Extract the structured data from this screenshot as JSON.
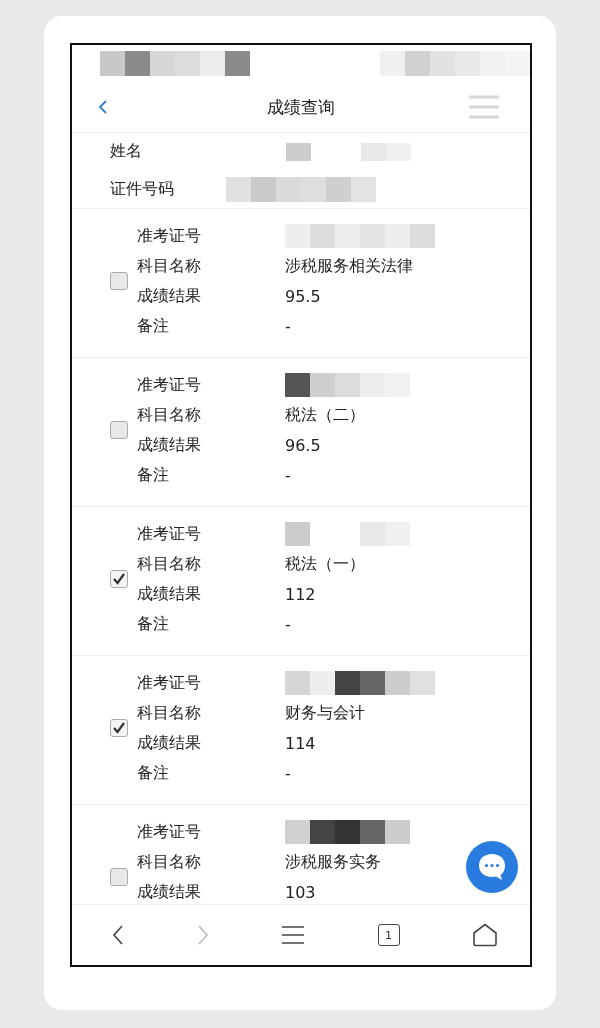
{
  "header": {
    "title": "成绩查询"
  },
  "profile": [
    {
      "label": "姓名",
      "kind": "redacted"
    },
    {
      "label": "证件号码",
      "kind": "redacted"
    }
  ],
  "records": [
    {
      "checked": false,
      "fields": [
        {
          "label": "准考证号",
          "kind": "redacted"
        },
        {
          "label": "科目名称",
          "kind": "text",
          "value": "涉税服务相关法律"
        },
        {
          "label": "成绩结果",
          "kind": "text",
          "value": "95.5"
        },
        {
          "label": "备注",
          "kind": "text",
          "value": "-"
        }
      ]
    },
    {
      "checked": false,
      "fields": [
        {
          "label": "准考证号",
          "kind": "redacted"
        },
        {
          "label": "科目名称",
          "kind": "text",
          "value": "税法（二）"
        },
        {
          "label": "成绩结果",
          "kind": "text",
          "value": "96.5"
        },
        {
          "label": "备注",
          "kind": "text",
          "value": "-"
        }
      ]
    },
    {
      "checked": true,
      "fields": [
        {
          "label": "准考证号",
          "kind": "redacted"
        },
        {
          "label": "科目名称",
          "kind": "text",
          "value": "税法（一）"
        },
        {
          "label": "成绩结果",
          "kind": "text",
          "value": "112"
        },
        {
          "label": "备注",
          "kind": "text",
          "value": "-"
        }
      ]
    },
    {
      "checked": true,
      "fields": [
        {
          "label": "准考证号",
          "kind": "redacted"
        },
        {
          "label": "科目名称",
          "kind": "text",
          "value": "财务与会计"
        },
        {
          "label": "成绩结果",
          "kind": "text",
          "value": "114"
        },
        {
          "label": "备注",
          "kind": "text",
          "value": "-"
        }
      ]
    },
    {
      "checked": false,
      "fields": [
        {
          "label": "准考证号",
          "kind": "redacted"
        },
        {
          "label": "科目名称",
          "kind": "text",
          "value": "涉税服务实务"
        },
        {
          "label": "成绩结果",
          "kind": "text",
          "value": "103"
        }
      ]
    }
  ],
  "bottom_nav": {
    "tab_count": "1"
  }
}
